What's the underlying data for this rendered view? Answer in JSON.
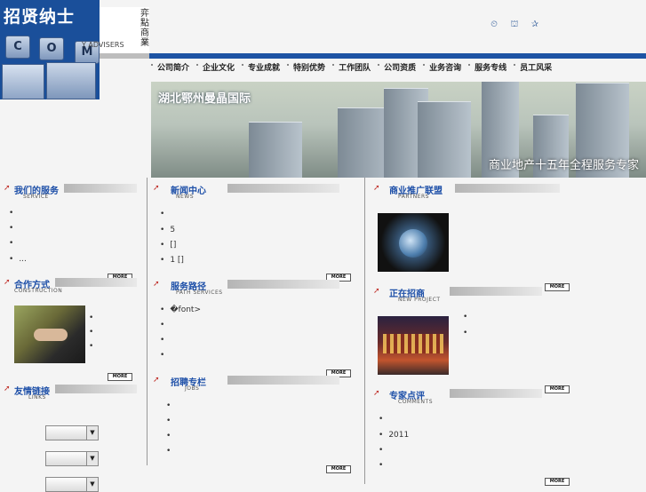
{
  "logo": {
    "title": "招贤纳士",
    "keys": [
      "C",
      "O",
      "M"
    ]
  },
  "brand": {
    "en": "Y ADVISERS",
    "cn": "弈\n點\n商\n業"
  },
  "top_icons": [
    "clock-icon",
    "sitemap-icon",
    "favorite-icon"
  ],
  "nav": [
    "公司简介",
    "企业文化",
    "专业成就",
    "特别优势",
    "工作团队",
    "公司资质",
    "业务咨询",
    "服务专线",
    "员工风采"
  ],
  "banner": {
    "location": "湖北鄂州曼晶国际",
    "slogan": "商业地产十五年全程服务专家"
  },
  "sections": {
    "services": {
      "title": "我们的服务",
      "sub": "SERVICE",
      "items": [
        "",
        "",
        "",
        "..."
      ]
    },
    "cooperation": {
      "title": "合作方式",
      "sub": "CONSTRUCTION",
      "more": "MORE",
      "items": [
        "",
        "",
        ""
      ]
    },
    "links": {
      "title": "友情链接",
      "sub": "LINKS",
      "more": "MORE"
    },
    "news": {
      "title": "新闻中心",
      "sub": "NEWS",
      "items": [
        "",
        "5",
        "[]",
        "1      []"
      ]
    },
    "path": {
      "title": "服务路径",
      "sub": "PATH SERVICES",
      "more": "MORE",
      "items": [
        "�font>",
        "",
        "",
        ""
      ]
    },
    "jobs": {
      "title": "招聘专栏",
      "sub": "JOBS",
      "more": "MORE",
      "items": [
        "",
        "",
        "",
        ""
      ],
      "more2": "MORE"
    },
    "partners": {
      "title": "商业推广联盟",
      "sub": "PARTNERS"
    },
    "invest": {
      "title": "正在招商",
      "sub": "NEW PROJECT",
      "more": "MORE",
      "items": [
        "",
        ""
      ]
    },
    "comments": {
      "title": "专家点评",
      "sub": "COMMENTS",
      "more": "MORE",
      "items": [
        "",
        "2011",
        "",
        ""
      ],
      "more2": "MORE"
    }
  },
  "colors": {
    "accent": "#1d54a4",
    "title": "#1d4fa8",
    "arrow": "#c0302a"
  }
}
